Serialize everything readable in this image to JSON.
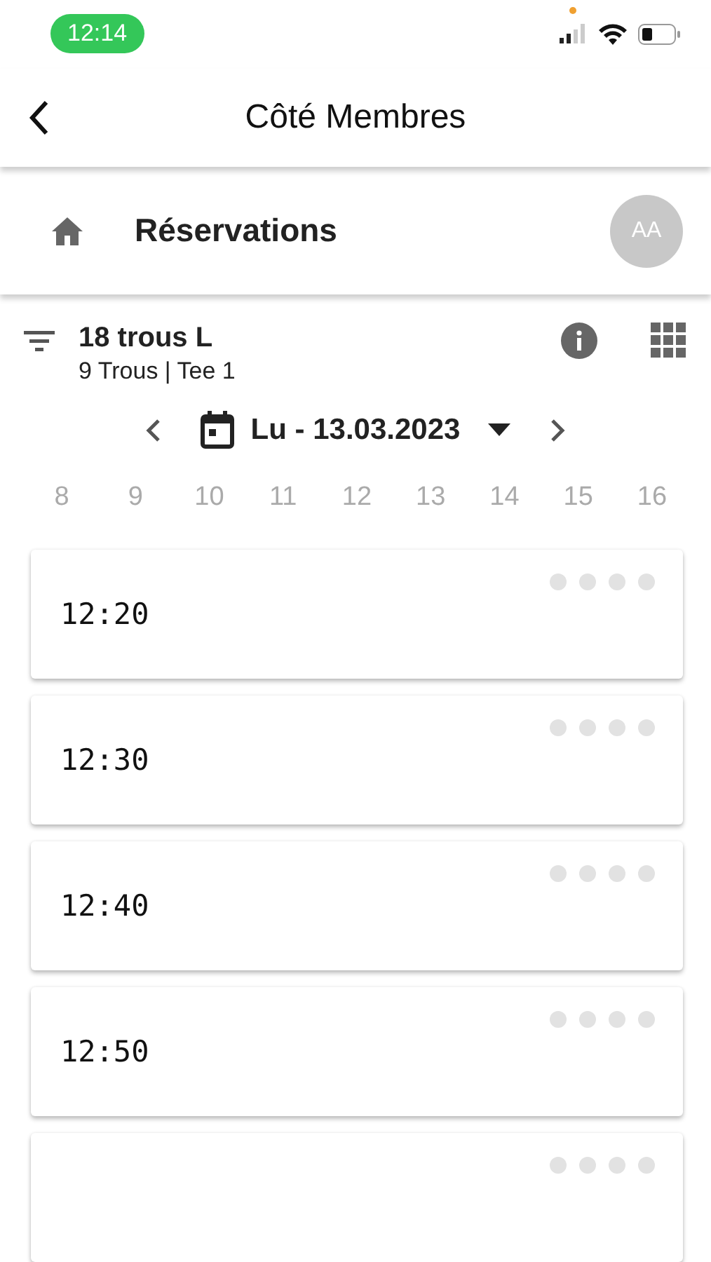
{
  "status_bar": {
    "time": "12:14"
  },
  "app_bar": {
    "title": "Côté Membres"
  },
  "section": {
    "title": "Réservations",
    "avatar": "AA"
  },
  "course": {
    "name": "18 trous L",
    "details": "9 Trous | Tee 1"
  },
  "date": {
    "label": "Lu - 13.03.2023"
  },
  "hours": [
    "8",
    "9",
    "10",
    "11",
    "12",
    "13",
    "14",
    "15",
    "16"
  ],
  "slots": [
    {
      "time": "12:20",
      "places": [
        {
          "taken": false
        },
        {
          "taken": false
        },
        {
          "taken": false
        },
        {
          "taken": false
        }
      ]
    },
    {
      "time": "12:30",
      "places": [
        {
          "taken": false
        },
        {
          "taken": false
        },
        {
          "taken": false
        },
        {
          "taken": false
        }
      ]
    },
    {
      "time": "12:40",
      "places": [
        {
          "taken": false
        },
        {
          "taken": false
        },
        {
          "taken": false
        },
        {
          "taken": false
        }
      ]
    },
    {
      "time": "12:50",
      "places": [
        {
          "taken": false
        },
        {
          "taken": false
        },
        {
          "taken": false
        },
        {
          "taken": false
        }
      ]
    },
    {
      "places": [
        {
          "taken": false
        },
        {
          "taken": false
        },
        {
          "taken": false
        },
        {
          "taken": false
        }
      ]
    }
  ]
}
